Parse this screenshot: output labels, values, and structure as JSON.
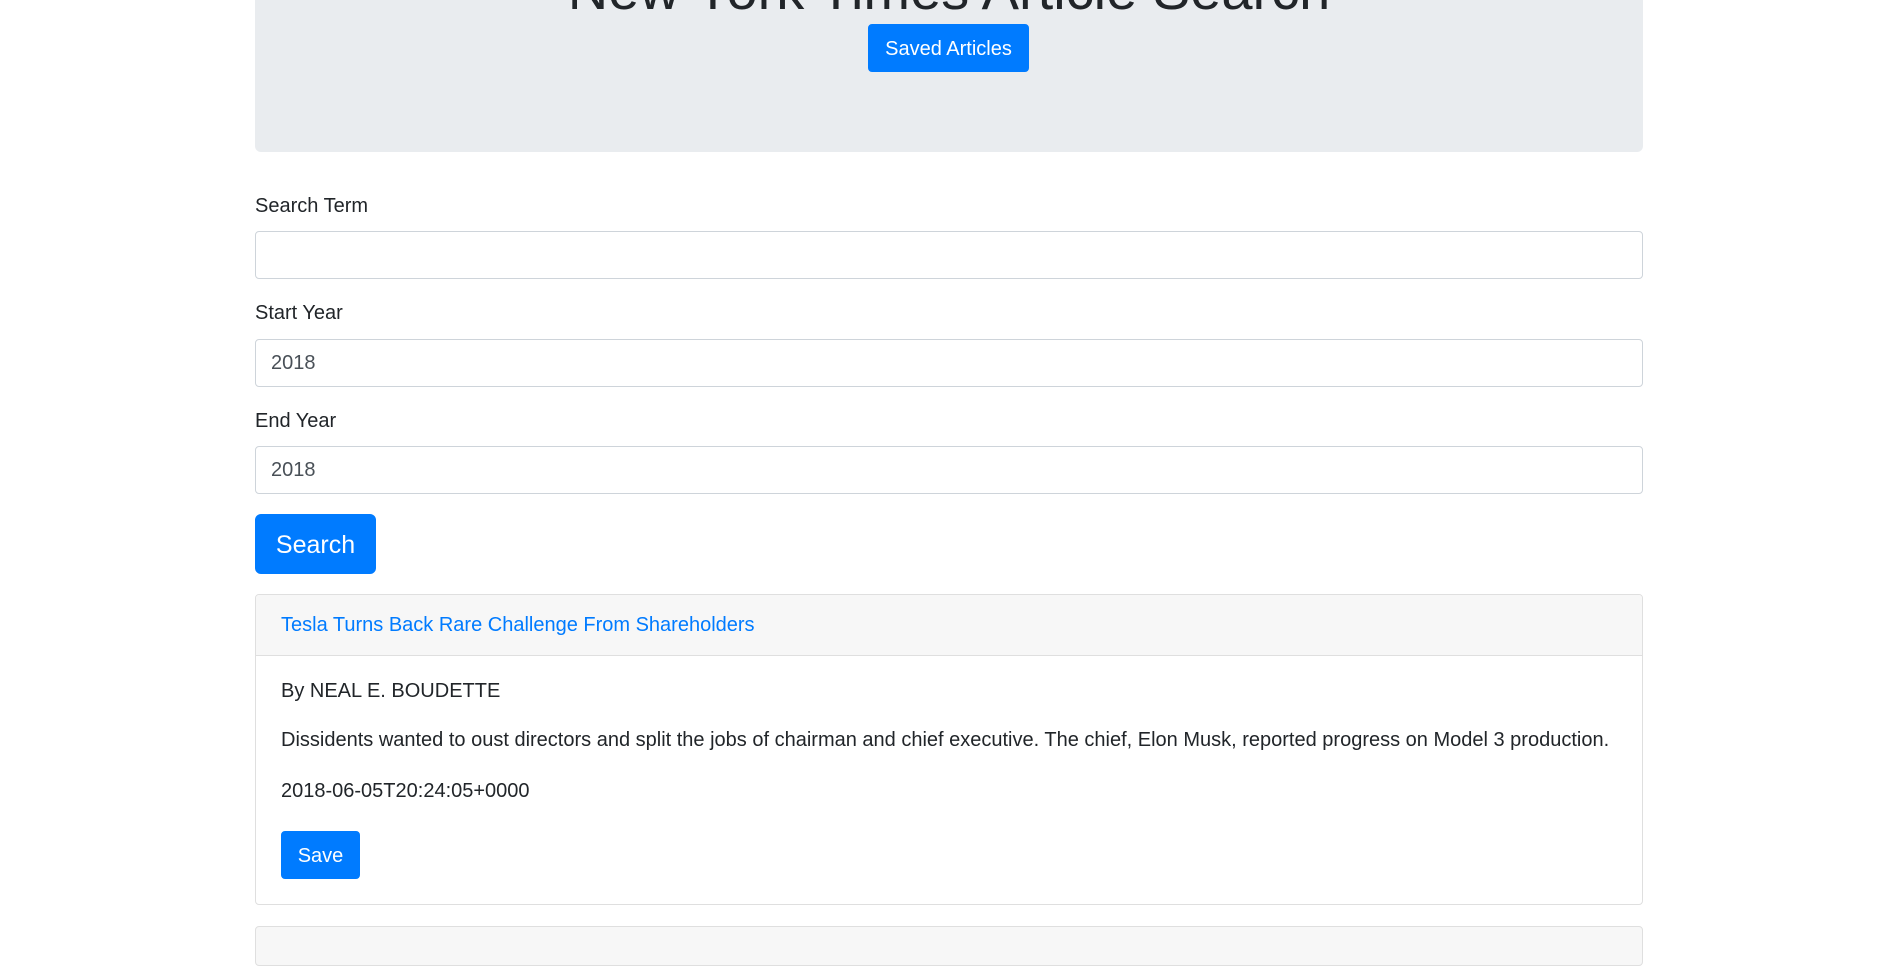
{
  "header": {
    "title": "New York Times Article Search",
    "saved_button": "Saved Articles"
  },
  "form": {
    "search_term": {
      "label": "Search Term",
      "value": ""
    },
    "start_year": {
      "label": "Start Year",
      "value": "2018"
    },
    "end_year": {
      "label": "End Year",
      "value": "2018"
    },
    "search_button": "Search"
  },
  "articles": [
    {
      "headline": "Tesla Turns Back Rare Challenge From Shareholders",
      "byline": "By NEAL E. BOUDETTE",
      "snippet": "Dissidents wanted to oust directors and split the jobs of chairman and chief executive. The chief, Elon Musk, reported progress on Model 3 production.",
      "date": "2018-06-05T20:24:05+0000",
      "save_button": "Save"
    }
  ],
  "colors": {
    "primary": "#007bff",
    "jumbotron_bg": "#e9ecef",
    "card_header_bg": "#f7f7f7"
  }
}
